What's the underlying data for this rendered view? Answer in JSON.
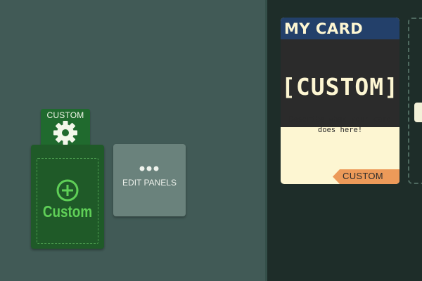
{
  "custom_tab": {
    "label": "CUSTOM",
    "icon": "gear-icon"
  },
  "custom_card": {
    "label": "Custom",
    "icon": "plus-icon"
  },
  "edit_panels": {
    "label": "EDIT PANELS",
    "icon": "dots-icon"
  },
  "my_card": {
    "title": "MY CARD",
    "art_text": "[CUSTOM]",
    "description": "Describe what your card does here!",
    "tag": "CUSTOM"
  },
  "colors": {
    "left_bg": "#415a56",
    "right_bg": "#1e2d29",
    "green_card": "#1f5a28",
    "card_header": "#23406a",
    "card_body": "#fdf6d2",
    "tag": "#ec9a59"
  }
}
